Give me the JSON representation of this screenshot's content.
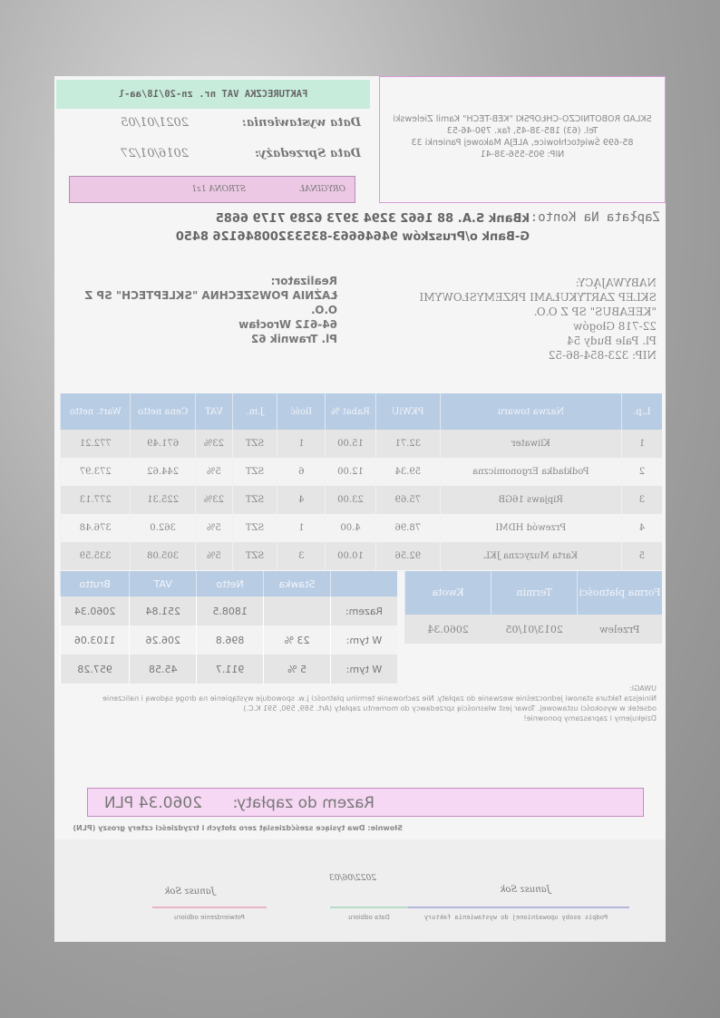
{
  "seller": {
    "name": "SKLAD ROBOTNICZO-CHŁOPSKI \"KEB-TECH\" Kamil Zielewski",
    "phone_fax": "Tel. (63) 185-38-45, fax. 790-46-53",
    "address": "85-699 Świętochłowice, ALEJA Makowej Panienki 33",
    "nip": "NIP: 905-556-38-41"
  },
  "invoice": {
    "title": "FAKTURECZKA VAT nr. zn-20/18/aa-l",
    "issue_label": "Data wystawienia:",
    "issue_date": "2021/01/05",
    "sale_label": "Data Sprzedaży:",
    "sale_date": "2016/01/27",
    "original_label": "ORYGINAŁ",
    "page_label": "STRONA 1z1"
  },
  "bank": {
    "label": "Zapłata Na Konto:",
    "line1": "kBank S.A. 88 1662 3294 3973 6289 7179 6685",
    "line2": "G-Bank o/Pruszków 94646663-83533200846126 8450"
  },
  "buyer": {
    "heading": "NABYWAJĄCY:",
    "name": "SKLEP ZARTYKUŁAMI PRZEMYSŁOWYMI",
    "name2": "\"KEEABUS\" SP Z O.O.",
    "city": "22-718 Głogów",
    "street": "Pl. Pale Budy 54",
    "nip": "NIP: 323-854-86-52"
  },
  "realizator": {
    "heading": "Realizator:",
    "name1": "ŁAŹNIA POWSZECHNA \"SKLEPTECH\" SP Z",
    "name2": "O.O.",
    "city": "64-612 Wrocław",
    "street": "Pl. Trawnik 62"
  },
  "items_table": {
    "headers": [
      "L.p.",
      "Nazwa towaru",
      "PKWiU",
      "Rabat %",
      "Ilość",
      "J.m.",
      "VAT",
      "Cena netto",
      "Wart. netto"
    ],
    "rows": [
      {
        "lp": "1",
        "name": "Kliwater",
        "pkwiu": "32.71",
        "rabat": "15.00",
        "qty": "1",
        "jm": "SZT",
        "vat": "23%",
        "price": "671.49",
        "net": "772.21"
      },
      {
        "lp": "2",
        "name": "Podkładka Ergonomiczna",
        "pkwiu": "59.34",
        "rabat": "12.00",
        "qty": "6",
        "jm": "SZT",
        "vat": "5%",
        "price": "244.62",
        "net": "273.97"
      },
      {
        "lp": "3",
        "name": "Ripjaws 16GB",
        "pkwiu": "75.69",
        "rabat": "23.00",
        "qty": "4",
        "jm": "SZT",
        "vat": "23%",
        "price": "225.31",
        "net": "277.13"
      },
      {
        "lp": "4",
        "name": "Przewód HDMI",
        "pkwiu": "78.96",
        "rabat": "4.00",
        "qty": "1",
        "jm": "SZT",
        "vat": "5%",
        "price": "362.0",
        "net": "376.48"
      },
      {
        "lp": "5",
        "name": "Karta Muzyczna JKL",
        "pkwiu": "92.56",
        "rabat": "10.00",
        "qty": "3",
        "jm": "SZT",
        "vat": "5%",
        "price": "305.08",
        "net": "335.59"
      }
    ]
  },
  "payment_table": {
    "headers": [
      "Forma płatności",
      "Termin",
      "Kwota"
    ],
    "row": {
      "form": "Przelew",
      "term": "2013/01/05",
      "amount": "2060.34"
    }
  },
  "summary_table": {
    "headers": [
      "",
      "Stawka",
      "Netto",
      "VAT",
      "Brutto"
    ],
    "rows": [
      {
        "label": "Razem:",
        "rate": "",
        "net": "1808.5",
        "vat": "251.84",
        "gross": "2060.34"
      },
      {
        "label": "W tym:",
        "rate": "23 %",
        "net": "896.8",
        "vat": "206.26",
        "gross": "1103.06"
      },
      {
        "label": "W tym:",
        "rate": "5 %",
        "net": "911.7",
        "vat": "45.58",
        "gross": "957.28"
      }
    ]
  },
  "notes": {
    "heading": "UWAGI:",
    "line1": "Niniejsza faktura stanowi jednocześnie wezwanie do zapłaty. Nie zachowanie terminu płatności j.w. spowoduje wystąpienie na drogę sądową i naliczenie",
    "line2": "odsetek w wysokości ustawowej. Towar jest własnością sprzedawcy do momentu zapłaty (Art. 589, 590, 591 K.C.)",
    "line3": "Dziękujemy i zapraszamy ponownie!"
  },
  "total": {
    "label": "Razem do zapłaty:",
    "amount": "2060.34 PLN",
    "words": "Słownie: Dwa tysiące sześćdziesiąt zero złotych i trzydzieści cztery groszy (PLN)"
  },
  "signatures": {
    "issuer_name": "Janusz Sok",
    "issuer_caption": "Podpis osoby upoważnionej do wystawienia faktury",
    "date": "2022/06/03",
    "date_caption": "Data odbioru",
    "receiver_name": "Janusz Sok",
    "receiver_caption": "Potwierdzenie odbioru"
  },
  "colors": {
    "seller_border": "#d89ad8",
    "title_box": "#c8ecdc",
    "original_box": "#ecc8e4",
    "table_header": "#b8cce4",
    "total_box": "#f7d8f4"
  }
}
